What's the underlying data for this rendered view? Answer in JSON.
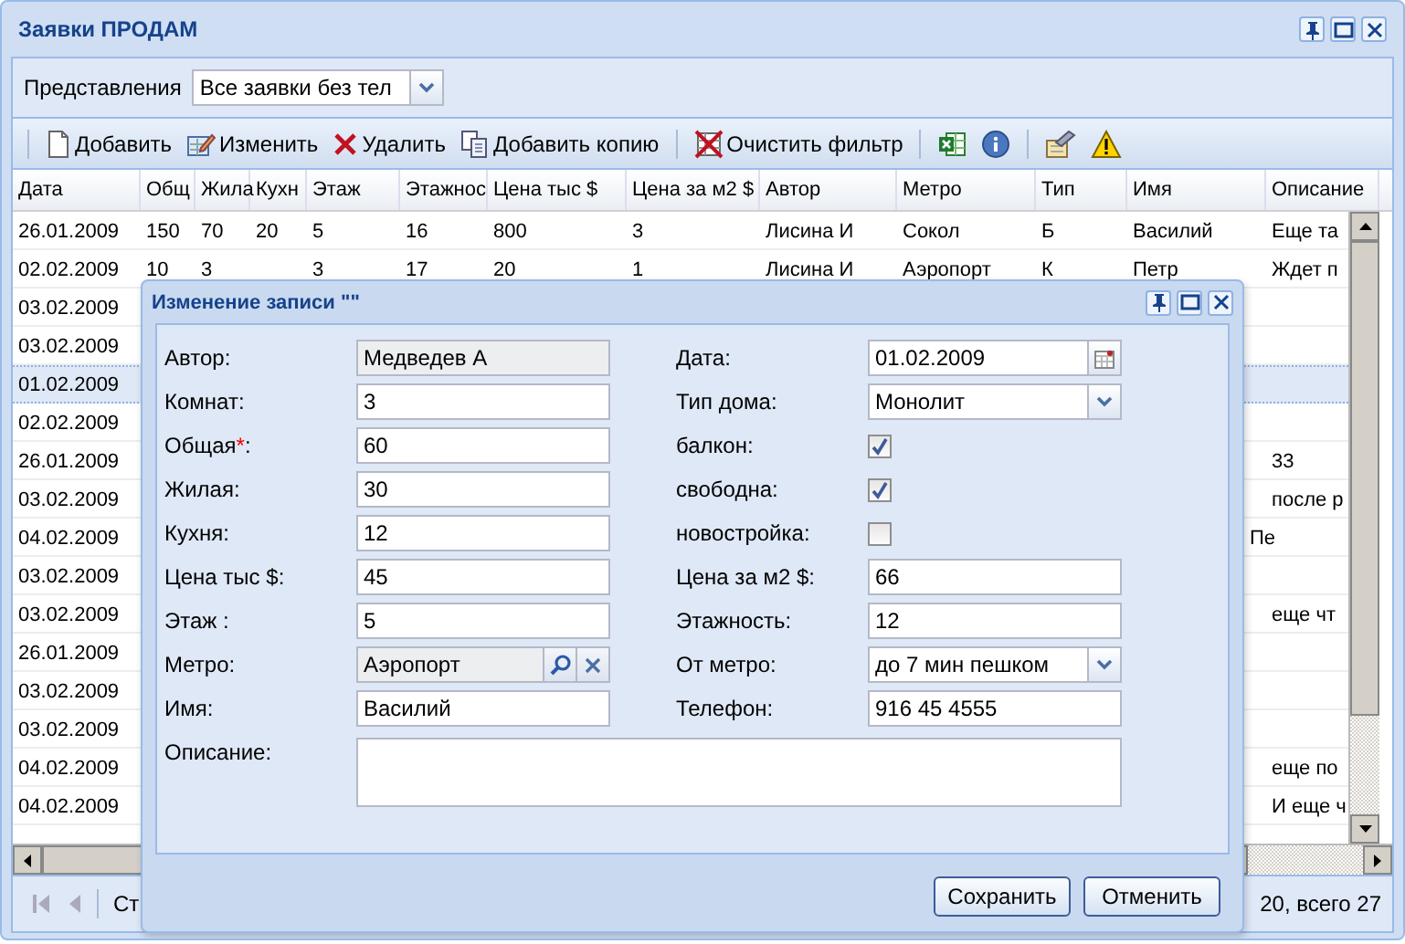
{
  "window": {
    "title": "Заявки ПРОДАМ"
  },
  "view_selector": {
    "label": "Представления",
    "value": "Все заявки без тел"
  },
  "toolbar_buttons": [
    "Добавить",
    "Изменить",
    "Удалить",
    "Добавить копию",
    "Очистить фильтр"
  ],
  "table": {
    "columns": [
      "Дата",
      "Общ",
      "Жила",
      "Кухн",
      "Этаж",
      "Этажнос",
      "Цена тыс $",
      "Цена за м2 $",
      "Автор",
      "Метро",
      "Тип",
      "Имя",
      "Описание"
    ],
    "rows": [
      {
        "selected": false,
        "date": "26.01.2009",
        "total": "150",
        "living": "70",
        "kitchen": "20",
        "floor": "5",
        "floors": "16",
        "price": "800",
        "price_m2": "3",
        "author": "Лисина И",
        "metro": "Сокол",
        "type": "Б",
        "name": "Василий",
        "description": "Еще та"
      },
      {
        "selected": false,
        "date": "02.02.2009",
        "total": "10",
        "living": "3",
        "floor": "3",
        "floors": "17",
        "price": "20",
        "price_m2": "1",
        "author": "Лисина И",
        "metro": "Аэропорт",
        "type": "К",
        "name": "Петр",
        "description": "Ждет п"
      },
      {
        "selected": false,
        "date": "03.02.2009"
      },
      {
        "selected": false,
        "date": "03.02.2009"
      },
      {
        "selected": true,
        "date": "01.02.2009"
      },
      {
        "selected": false,
        "date": "02.02.2009"
      },
      {
        "selected": false,
        "date": "26.01.2009",
        "description": "33"
      },
      {
        "selected": false,
        "date": "03.02.2009",
        "description": "после р"
      },
      {
        "selected": false,
        "date": "04.02.2009",
        "name_fragment": "Пе"
      },
      {
        "selected": false,
        "date": "03.02.2009"
      },
      {
        "selected": false,
        "date": "03.02.2009",
        "description": "еще чт"
      },
      {
        "selected": false,
        "date": "26.01.2009"
      },
      {
        "selected": false,
        "date": "03.02.2009"
      },
      {
        "selected": false,
        "date": "03.02.2009"
      },
      {
        "selected": false,
        "date": "04.02.2009",
        "description": "еще по"
      },
      {
        "selected": false,
        "date": "04.02.2009",
        "description": "И еще ч"
      }
    ]
  },
  "pager": {
    "page_label": "Ст",
    "summary": "20, всего 27"
  },
  "dialog": {
    "title": "Изменение записи \"\"",
    "left_fields": [
      {
        "kind": "text",
        "label": "Автор:",
        "value": "Медведев А",
        "readonly": true
      },
      {
        "kind": "text",
        "label": "Комнат:",
        "value": "3",
        "readonly": false
      },
      {
        "kind": "text",
        "label": "Общая",
        "required_mark": "*",
        "label_end": ":",
        "value": "60",
        "readonly": false
      },
      {
        "kind": "text",
        "label": "Жилая:",
        "value": "30",
        "readonly": false
      },
      {
        "kind": "text",
        "label": "Кухня:",
        "value": "12",
        "readonly": false
      },
      {
        "kind": "text",
        "label": "Цена тыс $:",
        "value": "45",
        "readonly": false
      },
      {
        "kind": "text",
        "label": "Этаж :",
        "value": "5",
        "readonly": false
      },
      {
        "kind": "lookup",
        "label": "Метро:",
        "value": "Аэропорт",
        "readonly": true
      },
      {
        "kind": "text",
        "label": "Имя:",
        "value": "Василий",
        "readonly": false
      }
    ],
    "right_fields": [
      {
        "kind": "date",
        "label": "Дата:",
        "value": "01.02.2009"
      },
      {
        "kind": "combo",
        "label": "Тип дома:",
        "value": "Монолит"
      },
      {
        "kind": "checkbox",
        "label": "балкон:",
        "checked": true
      },
      {
        "kind": "checkbox",
        "label": "свободна:",
        "checked": true
      },
      {
        "kind": "checkbox",
        "label": "новостройка:",
        "checked": false
      },
      {
        "kind": "text",
        "label": "Цена за м2 $:",
        "value": "66",
        "readonly": false
      },
      {
        "kind": "text",
        "label": "Этажность:",
        "value": "12",
        "readonly": false
      },
      {
        "kind": "combo",
        "label": "От метро:",
        "value": "до 7 мин пешком"
      },
      {
        "kind": "text",
        "label": "Телефон:",
        "value": "916  45 4555",
        "readonly": false
      }
    ],
    "description": {
      "label": "Описание:"
    },
    "buttons": [
      "Сохранить",
      "Отменить"
    ]
  }
}
